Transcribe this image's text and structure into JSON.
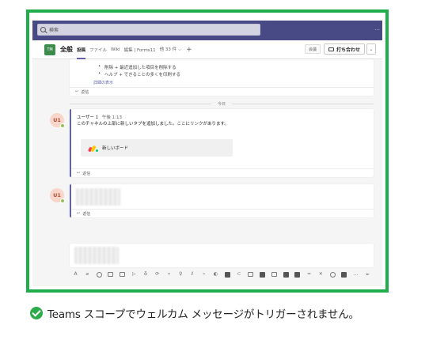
{
  "search": {
    "placeholder": "検索"
  },
  "topbar": {
    "more": "…"
  },
  "channel": {
    "team_initials": "TM",
    "name": "全般",
    "tabs": [
      {
        "label": "投稿",
        "active": true
      },
      {
        "label": "ファイル"
      },
      {
        "label": "Wiki"
      },
      {
        "label": "編集 | Forms11"
      },
      {
        "label": "他 33 件 ⌵"
      }
    ],
    "add_tab": "+",
    "watch_label": "会議",
    "meet_label": "打ち合わせ",
    "dropdown": "⌄"
  },
  "card1": {
    "bullets": [
      "削除 + 最近追加した項目を削除する",
      "ヘルプ + できることの多くを印刷する"
    ],
    "more_link": "詳細の表示",
    "reply": "返信"
  },
  "divider": {
    "label": "今日"
  },
  "message": {
    "avatar": "U1",
    "author": "ユーザー 1",
    "time": "午後 1:13",
    "text": "このチャネルの上部に新しいタブを追加しました。ここにリンクがあります。",
    "tab_card_label": "新しいボード",
    "reply": "返信"
  },
  "message2": {
    "avatar": "U1",
    "reply": "返信"
  },
  "composer": {
    "icons": [
      "format-icon",
      "attach-icon",
      "emoji-icon",
      "gif-icon",
      "sticker-icon",
      "meet-icon",
      "praise-icon",
      "loop-icon",
      "location-icon",
      "approvals-icon",
      "forms-icon",
      "board-icon",
      "record-icon",
      "stream-icon",
      "updates-icon",
      "onenote-icon",
      "planner-icon",
      "wiki-icon",
      "excel-icon",
      "table-icon",
      "divider-icon",
      "close-app-icon",
      "whiteboard-icon",
      "video-icon",
      "more-icon",
      "send-icon"
    ]
  },
  "caption": {
    "text": "Teams スコープでウェルカム メッセージがトリガーされません。"
  },
  "colors": {
    "frame": "#1fae4b",
    "accent": "#6264a7",
    "topbar": "#474a85",
    "check": "#2dab4a"
  }
}
